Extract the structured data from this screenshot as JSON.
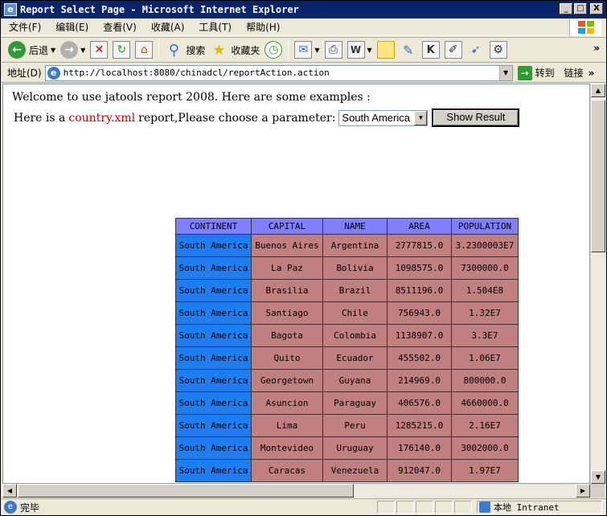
{
  "window": {
    "title": "Report Select Page - Microsoft Internet Explorer",
    "min_label": "_",
    "max_label": "□",
    "close_label": "X"
  },
  "menu": {
    "items": [
      "文件(F)",
      "编辑(E)",
      "查看(V)",
      "收藏(A)",
      "工具(T)",
      "帮助(H)"
    ]
  },
  "toolbar": {
    "back_label": "后退",
    "search_label": "搜索",
    "favorites_label": "收藏夹",
    "more": "»"
  },
  "address": {
    "label": "地址(D)",
    "url": "http://localhost:8080/chinadcl/reportAction.action",
    "go_label": "转到",
    "links_label": "链接",
    "links_more": "»"
  },
  "page": {
    "welcome": "Welcome to use jatools report 2008. Here are some examples :",
    "param_prefix": "Here is a",
    "param_link": "country.xml",
    "param_suffix": "report,Please choose a parameter:",
    "selected_param": "South America",
    "show_button": "Show Result"
  },
  "table": {
    "headers": [
      "CONTINENT",
      "CAPITAL",
      "NAME",
      "AREA",
      "POPULATION"
    ],
    "rows": [
      [
        "South America",
        "Buenos Aires",
        "Argentina",
        "2777815.0",
        "3.2300003E7"
      ],
      [
        "South America",
        "La Paz",
        "Bolivia",
        "1098575.0",
        "7300000.0"
      ],
      [
        "South America",
        "Brasilia",
        "Brazil",
        "8511196.0",
        "1.504E8"
      ],
      [
        "South America",
        "Santiago",
        "Chile",
        "756943.0",
        "1.32E7"
      ],
      [
        "South America",
        "Bagota",
        "Colombia",
        "1138907.0",
        "3.3E7"
      ],
      [
        "South America",
        "Quito",
        "Ecuador",
        "455502.0",
        "1.06E7"
      ],
      [
        "South America",
        "Georgetown",
        "Guyana",
        "214969.0",
        "800000.0"
      ],
      [
        "South America",
        "Asuncion",
        "Paraguay",
        "406576.0",
        "4660000.0"
      ],
      [
        "South America",
        "Lima",
        "Peru",
        "1285215.0",
        "2.16E7"
      ],
      [
        "South America",
        "Montevideo",
        "Uruguay",
        "176140.0",
        "3002000.0"
      ],
      [
        "South America",
        "Caracas",
        "Venezuela",
        "912047.0",
        "1.97E7"
      ]
    ]
  },
  "status": {
    "text": "完毕",
    "zone": "本地 Intranet"
  },
  "colors": {
    "header_bg": "#8080ff",
    "continent_bg": "#1e7ef0",
    "value_bg": "#c08080",
    "link_red": "#c00000"
  }
}
